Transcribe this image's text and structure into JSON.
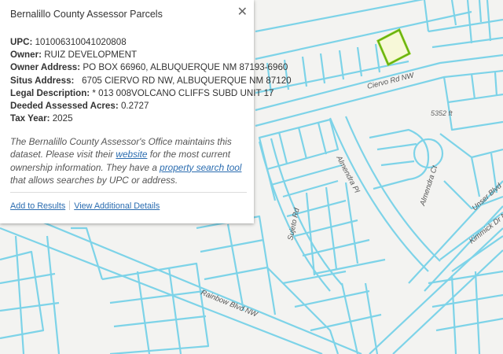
{
  "popup": {
    "title": "Bernalillo County Assessor Parcels",
    "close_icon": "close-icon",
    "fields": [
      {
        "label": "UPC:",
        "value": "101006310041020808"
      },
      {
        "label": "Owner:",
        "value": "RUIZ DEVELOPMENT"
      },
      {
        "label": "Owner Address:",
        "value": "PO BOX 66960, ALBUQUERQUE NM 87193-6960"
      },
      {
        "label": "Situs Address:",
        "value": "6705 CIERVO RD NW, ALBUQUERQUE NM 87120"
      },
      {
        "label": "Legal Description:",
        "value": "* 013 008VOLCANO CLIFFS SUBD UNIT 17"
      },
      {
        "label": "Deeded Assessed Acres:",
        "value": "0.2727"
      },
      {
        "label": "Tax Year:",
        "value": "2025"
      }
    ],
    "description": {
      "part1": "The Bernalillo County Assessor's Office maintains this dataset. Please visit their ",
      "link1": "website",
      "part2": " for the most current ownership information. They have a ",
      "link2": "property search tool",
      "part3": " that allows searches by UPC or address."
    },
    "actions": {
      "add_to_results": "Add to Results",
      "view_details": "View Additional Details"
    }
  },
  "map": {
    "parcel_stroke": "#7dd3e8",
    "selected_outline": "#8ccf1f",
    "road_labels": {
      "ciervo": "Ciervo Rd NW",
      "almendra_pl": "Almendra Pl",
      "almendra_ct": "Almendra Ct",
      "sujeto": "Sujeto Rd",
      "rainbow": "Rainbow Blvd NW",
      "unser": "Unser Blvd",
      "kimmick": "Kimmick Dr NW"
    },
    "elevation_label": "5352 ft"
  }
}
